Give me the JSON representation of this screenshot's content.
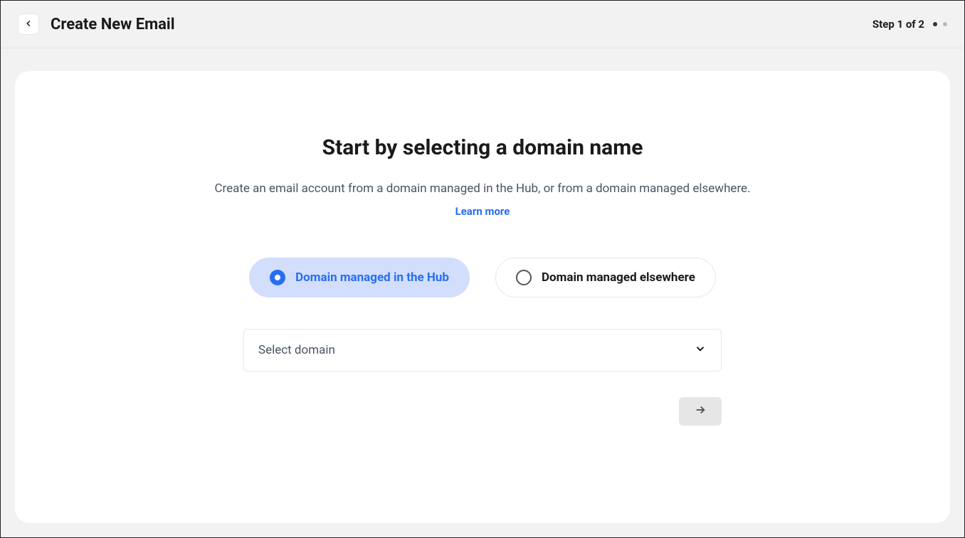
{
  "header": {
    "title": "Create New Email",
    "step_label": "Step 1 of 2"
  },
  "card": {
    "heading": "Start by selecting a domain name",
    "subheading_prefix": "Create an email account from a domain managed in the Hub, or from a domain managed elsewhere. ",
    "learn_more": "Learn more"
  },
  "options": {
    "hub": "Domain managed in the Hub",
    "elsewhere": "Domain managed elsewhere"
  },
  "select": {
    "placeholder": "Select domain"
  }
}
